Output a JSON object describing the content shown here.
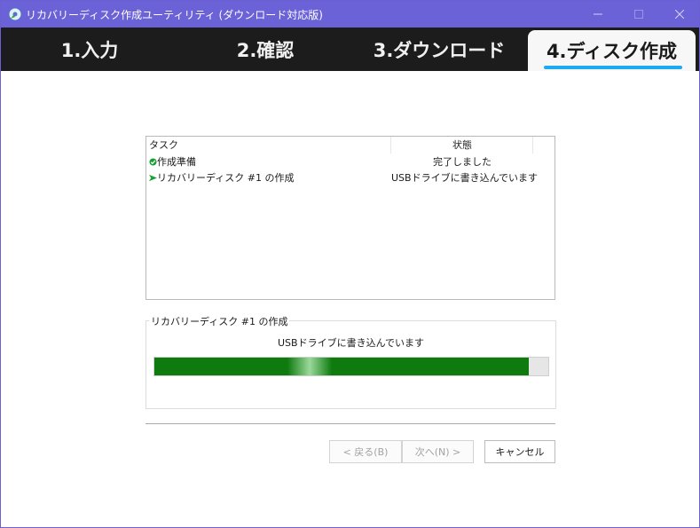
{
  "window": {
    "title": "リカバリーディスク作成ユーティリティ (ダウンロード対応版)"
  },
  "tabs": [
    {
      "label": "1.入力"
    },
    {
      "label": "2.確認"
    },
    {
      "label": "3.ダウンロード"
    },
    {
      "label": "4.ディスク作成",
      "active": true
    }
  ],
  "task_list": {
    "columns": {
      "task": "タスク",
      "status": "状態"
    },
    "rows": [
      {
        "task": "作成準備",
        "status": "完了しました",
        "icon": "check-icon"
      },
      {
        "task": "リカバリーディスク #1 の作成",
        "status": "USBドライブに書き込んでいます",
        "icon": "arrow-right-icon"
      }
    ]
  },
  "progress_group": {
    "legend": "リカバリーディスク #1 の作成",
    "caption": "USBドライブに書き込んでいます",
    "progress_fraction": 0.95
  },
  "buttons": {
    "back": "< 戻る(B)",
    "next": "次へ(N) >",
    "cancel": "キャンセル"
  },
  "colors": {
    "titlebar": "#6a62d6",
    "tabbar": "#1c1c1c",
    "active_tab_underline": "#1eaaf1",
    "progress_fill": "#0f7b0f"
  }
}
